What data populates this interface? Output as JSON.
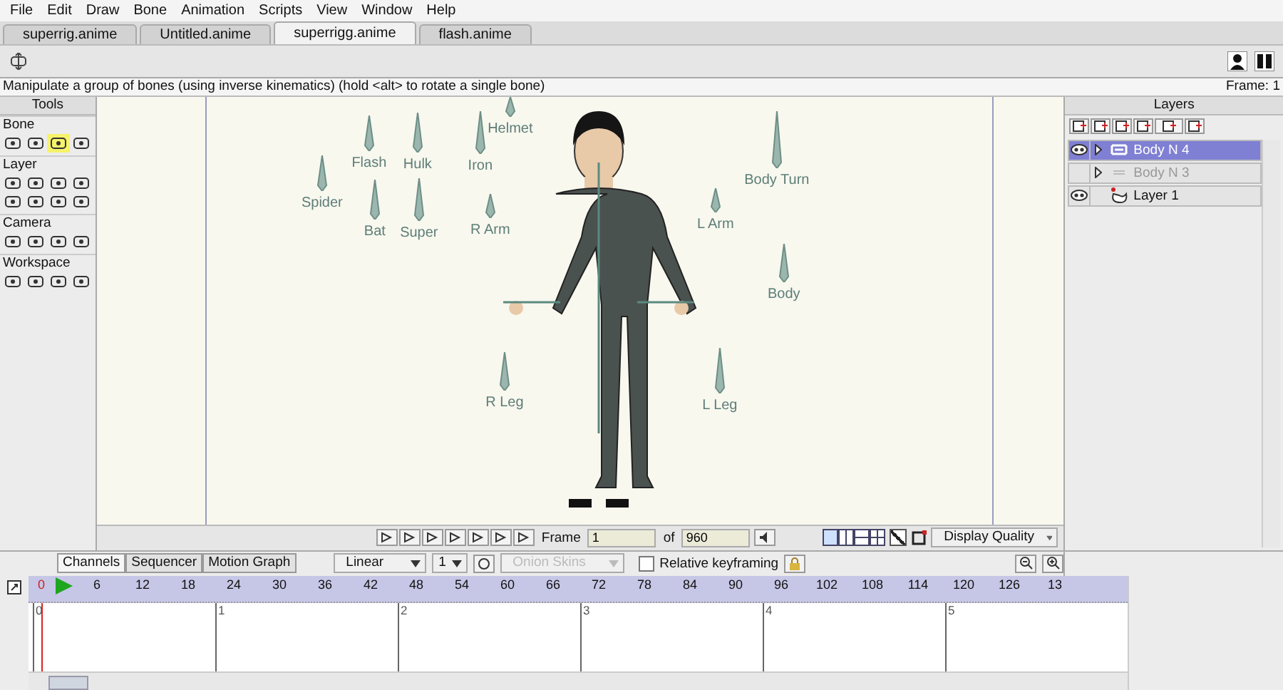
{
  "menu": [
    "File",
    "Edit",
    "Draw",
    "Bone",
    "Animation",
    "Scripts",
    "View",
    "Window",
    "Help"
  ],
  "tabs": [
    {
      "label": "superrig.anime",
      "selected": false
    },
    {
      "label": "Untitled.anime",
      "selected": false
    },
    {
      "label": "superrigg.anime",
      "selected": true
    },
    {
      "label": "flash.anime",
      "selected": false
    }
  ],
  "status": {
    "hint": "Manipulate a group of bones (using inverse kinematics) (hold <alt> to rotate a single bone)",
    "frame": "Frame: 1"
  },
  "tools": {
    "title": "Tools",
    "groups": [
      {
        "name": "Bone",
        "tools": [
          {
            "selected": false
          },
          {
            "selected": false
          },
          {
            "selected": true
          },
          {
            "selected": false
          }
        ]
      },
      {
        "name": "Layer",
        "tools": [
          {
            "selected": false
          },
          {
            "selected": false
          },
          {
            "selected": false
          },
          {
            "selected": false
          },
          {
            "selected": false
          },
          {
            "selected": false
          },
          {
            "selected": false
          },
          {
            "selected": false
          }
        ]
      },
      {
        "name": "Camera",
        "tools": [
          {
            "selected": false
          },
          {
            "selected": false
          },
          {
            "selected": false
          },
          {
            "selected": false
          }
        ]
      },
      {
        "name": "Workspace",
        "tools": [
          {
            "selected": false
          },
          {
            "selected": false
          },
          {
            "selected": false
          },
          {
            "selected": false
          }
        ]
      }
    ]
  },
  "bones": [
    {
      "label": "Helmet"
    },
    {
      "label": "Flash"
    },
    {
      "label": "Hulk"
    },
    {
      "label": "Iron"
    },
    {
      "label": "Spider"
    },
    {
      "label": "Bat"
    },
    {
      "label": "Super"
    },
    {
      "label": "R Arm"
    },
    {
      "label": "Body Turn"
    },
    {
      "label": "L Arm"
    },
    {
      "label": "Body"
    },
    {
      "label": "R Leg"
    },
    {
      "label": "L Leg"
    }
  ],
  "playback": {
    "frame_label": "Frame",
    "frame": "1",
    "of_label": "of",
    "total": "960",
    "show_checked": true,
    "quality": "Display Quality"
  },
  "layers": {
    "title": "Layers",
    "items": [
      {
        "name": "Body N 4",
        "kind": "bone",
        "visible": true,
        "selected": true
      },
      {
        "name": "Body N 3",
        "kind": "switch",
        "visible": false,
        "selected": false
      },
      {
        "name": "Layer 1",
        "kind": "vector",
        "visible": true,
        "selected": false
      }
    ]
  },
  "timeline": {
    "tabs": [
      {
        "label": "Channels",
        "selected": true
      },
      {
        "label": "Sequencer",
        "selected": false
      },
      {
        "label": "Motion Graph",
        "selected": false
      }
    ],
    "interpolation": "Linear",
    "step": "1",
    "onion": "Onion Skins",
    "relative": {
      "label": "Relative keyframing",
      "checked": false
    },
    "frames": [
      "0",
      "6",
      "12",
      "18",
      "24",
      "30",
      "36",
      "42",
      "48",
      "54",
      "60",
      "66",
      "72",
      "78",
      "84",
      "90",
      "96",
      "102",
      "108",
      "114",
      "120",
      "126",
      "13"
    ],
    "seconds": [
      "0",
      "1",
      "2",
      "3",
      "4",
      "5"
    ]
  }
}
